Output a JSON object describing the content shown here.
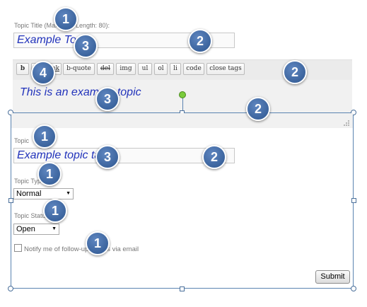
{
  "form": {
    "title_label": "Topic Title (Maximum Length: 80):",
    "title_value": "Example To",
    "content_text": "This is an example topic",
    "tags_label": "Topic",
    "tags_value": "Example topic ta",
    "type_label": "Topic Type",
    "type_selected": "Normal",
    "status_label": "Topic Status",
    "status_selected": "Open",
    "notify_label": "Notify me of follow-up replies via email",
    "submit_label": "Submit"
  },
  "toolbar": {
    "buttons": [
      "b",
      "i",
      "link",
      "b-quote",
      "del",
      "img",
      "ul",
      "ol",
      "li",
      "code",
      "close tags"
    ]
  },
  "callouts": [
    "1",
    "2",
    "3",
    "4",
    "2",
    "3",
    "2",
    "1",
    "3",
    "2",
    "1",
    "1",
    "1"
  ],
  "colors": {
    "content_text": "#2233bb",
    "badge": "#3a64a0",
    "frame": "#5b84b1",
    "rotate_handle": "#7acb3c"
  }
}
